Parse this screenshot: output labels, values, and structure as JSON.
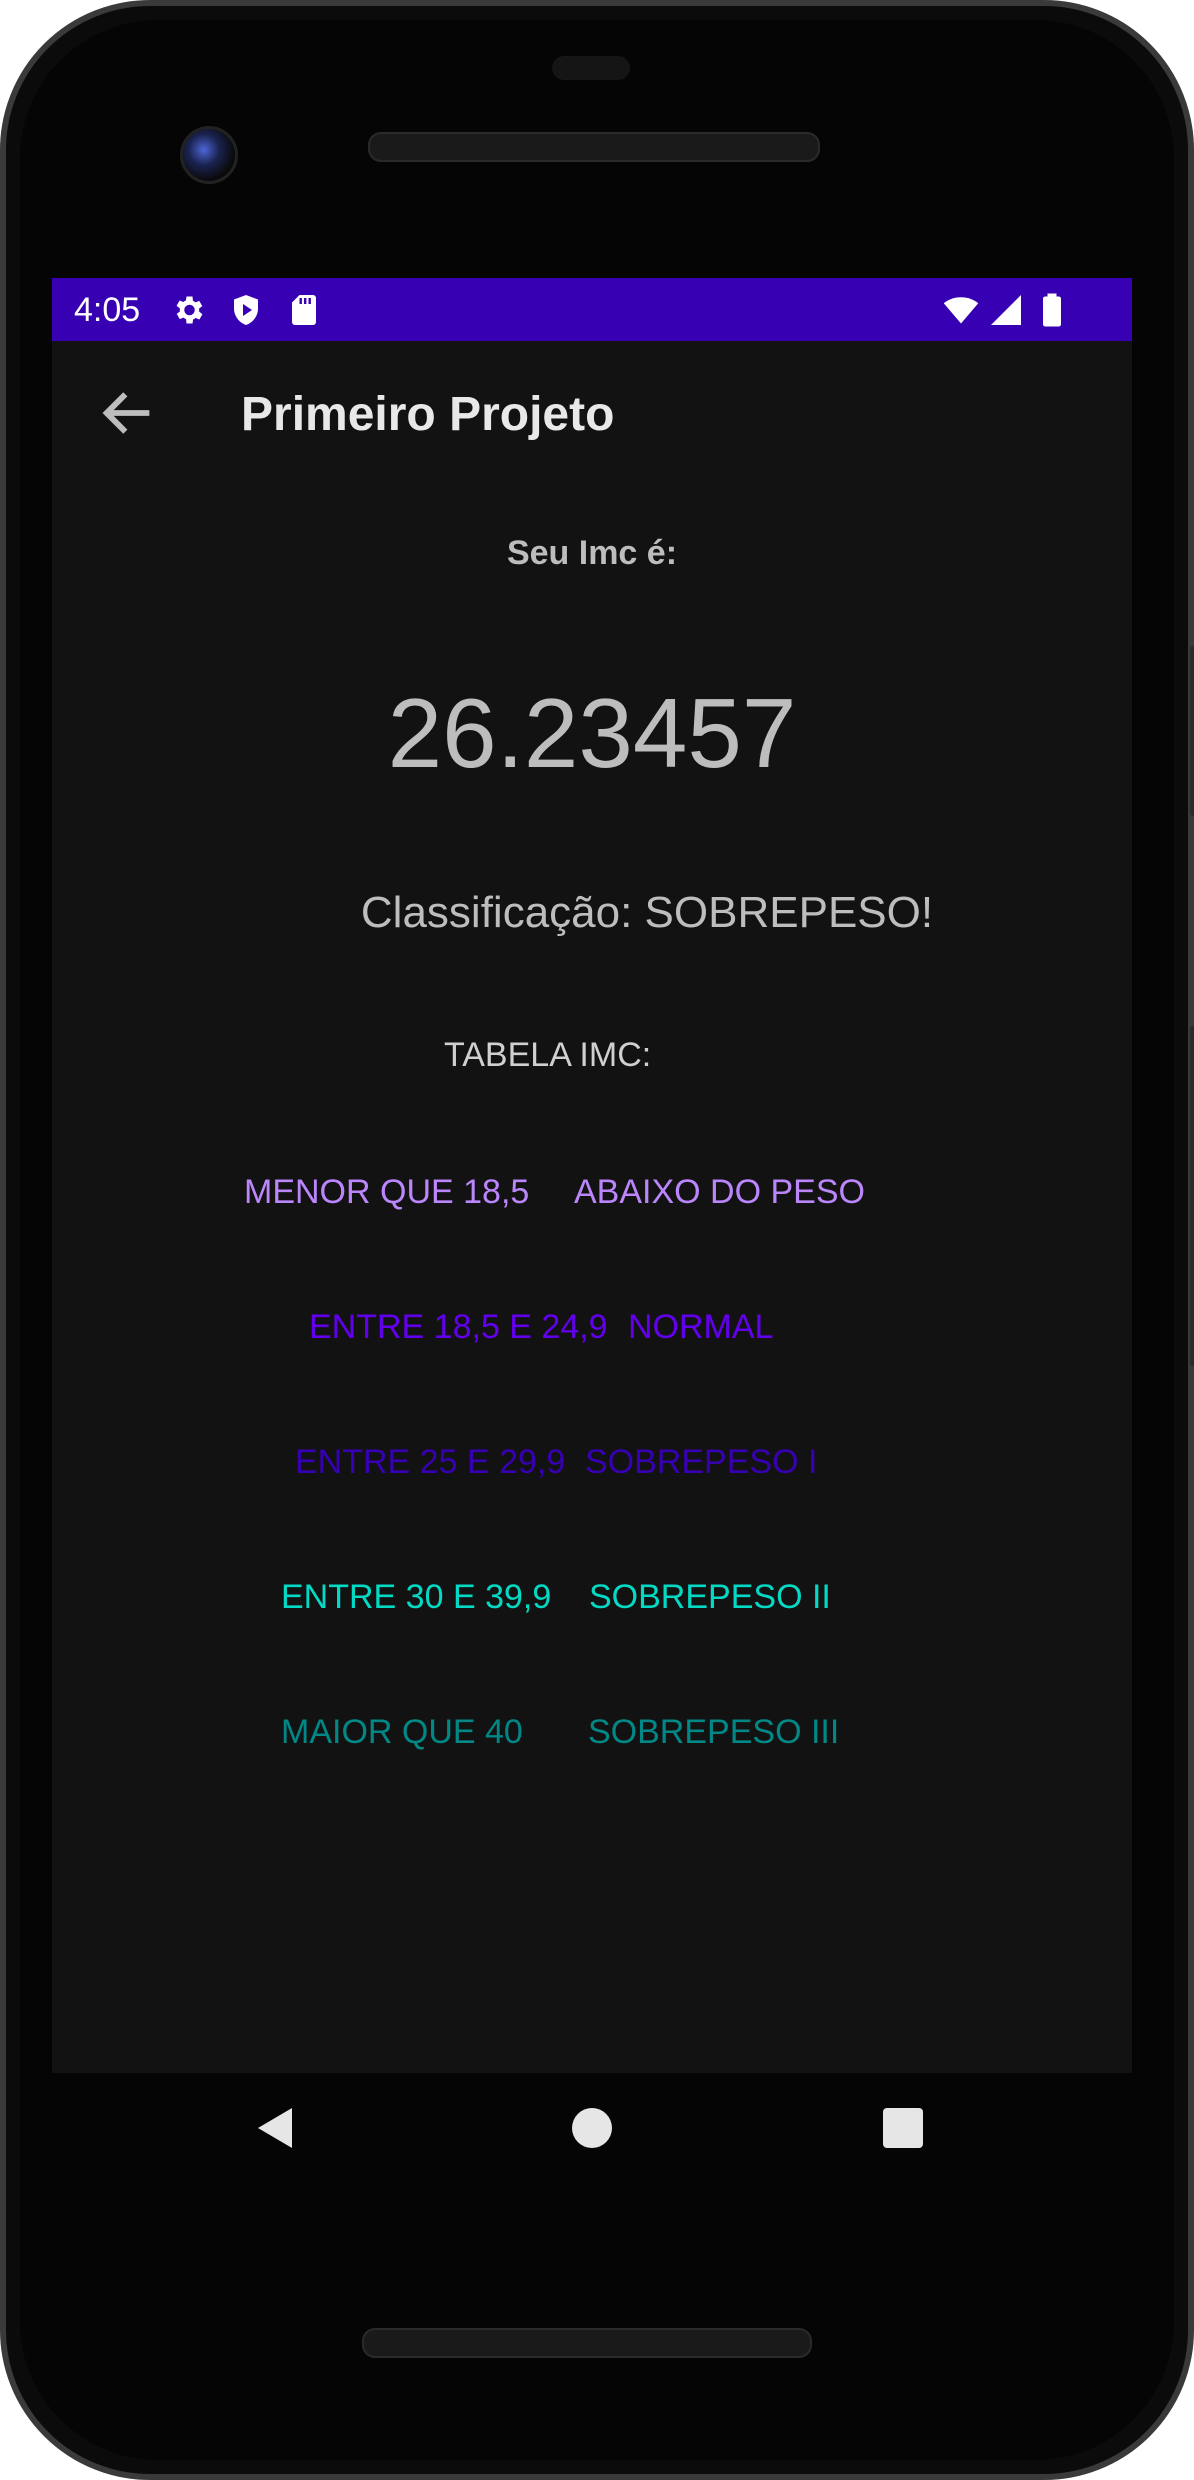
{
  "status_bar": {
    "time": "4:05",
    "background": "#3700b3",
    "left_icons": [
      "gear-icon",
      "shield-play-icon",
      "sd-card-icon"
    ],
    "right_icons": [
      "wifi-icon",
      "signal-icon",
      "battery-icon"
    ]
  },
  "app_bar": {
    "title": "Primeiro Projeto",
    "back_icon": "arrow-left-icon"
  },
  "result": {
    "label": "Seu Imc é:",
    "value": "26.23457",
    "classification": "Classificação: SOBREPESO!"
  },
  "table": {
    "title": "TABELA IMC:",
    "rows": [
      {
        "range": "MENOR QUE 18,5",
        "category": "ABAIXO DO PESO",
        "color": "#bb86fc"
      },
      {
        "range": "ENTRE 18,5 E 24,9",
        "category": "NORMAL",
        "color": "#6200ee"
      },
      {
        "range": "ENTRE 25 E 29,9",
        "category": "SOBREPESO I",
        "color": "#3700b3"
      },
      {
        "range": "ENTRE 30 E 39,9",
        "category": "SOBREPESO II",
        "color": "#03dac5"
      },
      {
        "range": "MAIOR QUE 40",
        "category": "SOBREPESO III",
        "color": "#018786"
      }
    ]
  },
  "nav": {
    "back_icon": "triangle-back-icon",
    "home_icon": "circle-home-icon",
    "recents_icon": "square-recents-icon"
  }
}
